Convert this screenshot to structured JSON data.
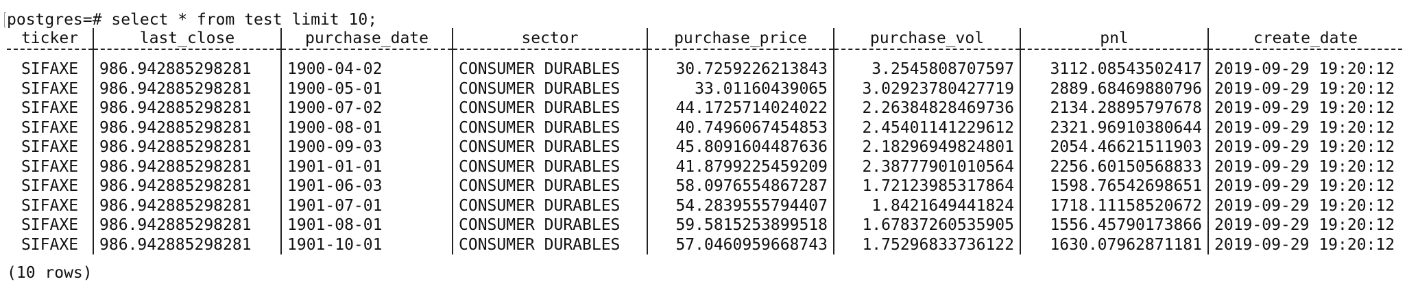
{
  "terminal": {
    "prompt": "postgres=#",
    "command": "select * from test limit 10;"
  },
  "table": {
    "columns": [
      "ticker",
      "last_close",
      "purchase_date",
      "sector",
      "purchase_price",
      "purchase_vol",
      "pnl",
      "create_date"
    ],
    "rows": [
      [
        "SIFAXE",
        "986.942885298281",
        "1900-04-02",
        "CONSUMER DURABLES",
        "30.7259226213843",
        "3.2545808707597",
        "3112.08543502417",
        "2019-09-29 19:20:12"
      ],
      [
        "SIFAXE",
        "986.942885298281",
        "1900-05-01",
        "CONSUMER DURABLES",
        "33.01160439065",
        "3.02923780427719",
        "2889.68469880796",
        "2019-09-29 19:20:12"
      ],
      [
        "SIFAXE",
        "986.942885298281",
        "1900-07-02",
        "CONSUMER DURABLES",
        "44.1725714024022",
        "2.26384828469736",
        "2134.28895797678",
        "2019-09-29 19:20:12"
      ],
      [
        "SIFAXE",
        "986.942885298281",
        "1900-08-01",
        "CONSUMER DURABLES",
        "40.7496067454853",
        "2.45401141229612",
        "2321.96910380644",
        "2019-09-29 19:20:12"
      ],
      [
        "SIFAXE",
        "986.942885298281",
        "1900-09-03",
        "CONSUMER DURABLES",
        "45.8091604487636",
        "2.18296949824801",
        "2054.46621511903",
        "2019-09-29 19:20:12"
      ],
      [
        "SIFAXE",
        "986.942885298281",
        "1901-01-01",
        "CONSUMER DURABLES",
        "41.8799225459209",
        "2.38777901010564",
        "2256.60150568833",
        "2019-09-29 19:20:12"
      ],
      [
        "SIFAXE",
        "986.942885298281",
        "1901-06-03",
        "CONSUMER DURABLES",
        "58.0976554867287",
        "1.72123985317864",
        "1598.76542698651",
        "2019-09-29 19:20:12"
      ],
      [
        "SIFAXE",
        "986.942885298281",
        "1901-07-01",
        "CONSUMER DURABLES",
        "54.2839555794407",
        "1.8421649441824",
        "1718.11158520672",
        "2019-09-29 19:20:12"
      ],
      [
        "SIFAXE",
        "986.942885298281",
        "1901-08-01",
        "CONSUMER DURABLES",
        "59.5815253899518",
        "1.67837260535905",
        "1556.45790173866",
        "2019-09-29 19:20:12"
      ],
      [
        "SIFAXE",
        "986.942885298281",
        "1901-10-01",
        "CONSUMER DURABLES",
        "57.0460959668743",
        "1.75296833736122",
        "1630.07962871181",
        "2019-09-29 19:20:12"
      ]
    ]
  },
  "footer": {
    "row_count": "(10 rows)"
  }
}
